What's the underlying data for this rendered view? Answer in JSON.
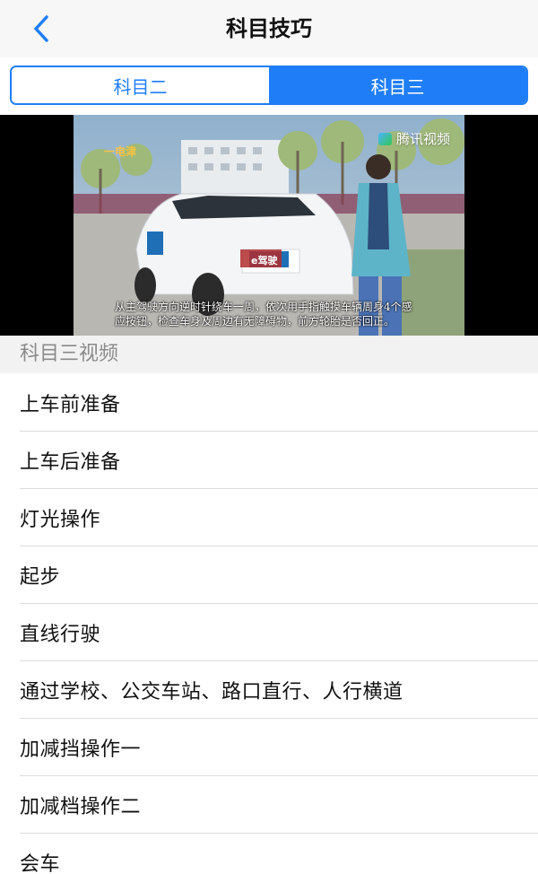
{
  "navbar": {
    "title": "科目技巧",
    "back_icon": "chevron-left-icon"
  },
  "segments": [
    {
      "label": "科目二",
      "selected": false
    },
    {
      "label": "科目三",
      "selected": true
    }
  ],
  "colors": {
    "accent": "#1f7ef7",
    "section_bg": "#f2f2f2",
    "section_text": "#8a8a8a",
    "divider": "#dcdcdc"
  },
  "video": {
    "watermark": "腾讯视频",
    "channel_logo": "一电津",
    "car_badge": "e驾驶",
    "subtitle_line1": "从主驾驶方向逆时针绕车一周，依次用手指触摸车辆周身4个感",
    "subtitle_line2": "应按钮，检查车身及周边有无障碍物，前方轮胎是否回正。"
  },
  "section": {
    "title": "科目三视频"
  },
  "items": [
    "上车前准备",
    "上车后准备",
    "灯光操作",
    "起步",
    "直线行驶",
    "通过学校、公交车站、路口直行、人行横道",
    "加减挡操作一",
    "加减档操作二",
    "会车"
  ]
}
